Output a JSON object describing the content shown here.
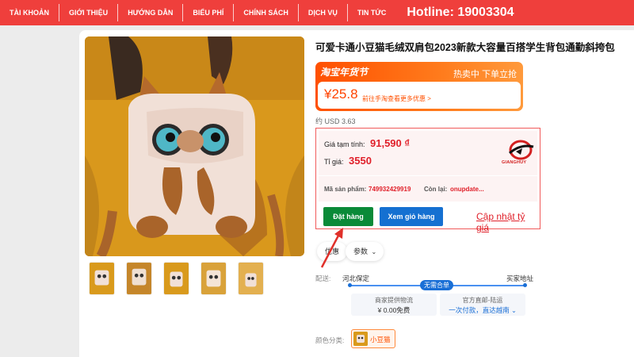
{
  "nav": {
    "items": [
      "TÀI KHOẢN",
      "GIỚI THIỆU",
      "HƯỚNG DẪN",
      "BIỂU PHÍ",
      "CHÍNH SÁCH",
      "DỊCH VỤ",
      "TIN TỨC"
    ],
    "hotline": "Hotline: 19003304"
  },
  "product": {
    "title": "可爱卡通小豆猫毛绒双肩包2023新款大容量百搭学生背包通勤斜挎包",
    "promo_label": "淘宝年货节",
    "promo_right": "热卖中 下单立抢",
    "price": "¥25.8",
    "promo_note": "前往手淘查看更多优惠 >",
    "usd": "约 USD 3.63"
  },
  "calc": {
    "temp_label": "Giá tạm tính:",
    "temp_value": "91,590 ₫",
    "rate_label": "Tỉ giá:",
    "rate_value": "3550",
    "brand_text": "GIANGHUY",
    "code_label": "Mã sản phẩm:",
    "code_value": "749932429919",
    "remaining_label": "Còn lại:",
    "remaining_value": "onupdate...",
    "order_button": "Đặt hàng",
    "cart_button": "Xem giỏ hàng",
    "update_link": "Cập nhật tỷ giá"
  },
  "pills": {
    "discount": "优惠",
    "params": "参数"
  },
  "shipping": {
    "label": "配送:",
    "from": "河北保定",
    "to": "买家地址",
    "badge": "无需合单",
    "box1_l1": "商家提供物流",
    "box1_l2": "¥ 0.00免费",
    "box2_l1": "官方直邮-陆运",
    "box2_l2": "一次付款，直达越南"
  },
  "color": {
    "label": "颜色分类:",
    "option": "小豆猫"
  },
  "colors": {
    "nav_bg": "#ef3f3c",
    "accent_orange": "#ff5000",
    "price_red": "#e0202a",
    "order_green": "#0a8a38",
    "cart_blue": "#1570d1"
  }
}
